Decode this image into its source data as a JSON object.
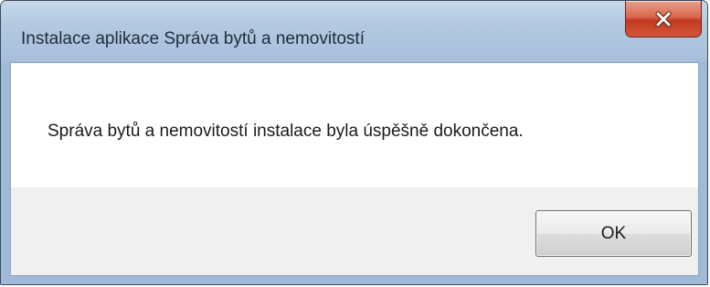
{
  "window": {
    "title": "Instalace aplikace Správa bytů a nemovitostí"
  },
  "dialog": {
    "message": "Správa bytů a nemovitostí instalace byla úspěšně dokončena.",
    "ok_label": "OK"
  },
  "icons": {
    "close": "close-icon"
  },
  "colors": {
    "titlebar": "#b3c9e1",
    "close_button": "#c13a1f",
    "content_background": "#ffffff",
    "button_area_background": "#f0f0f0"
  }
}
